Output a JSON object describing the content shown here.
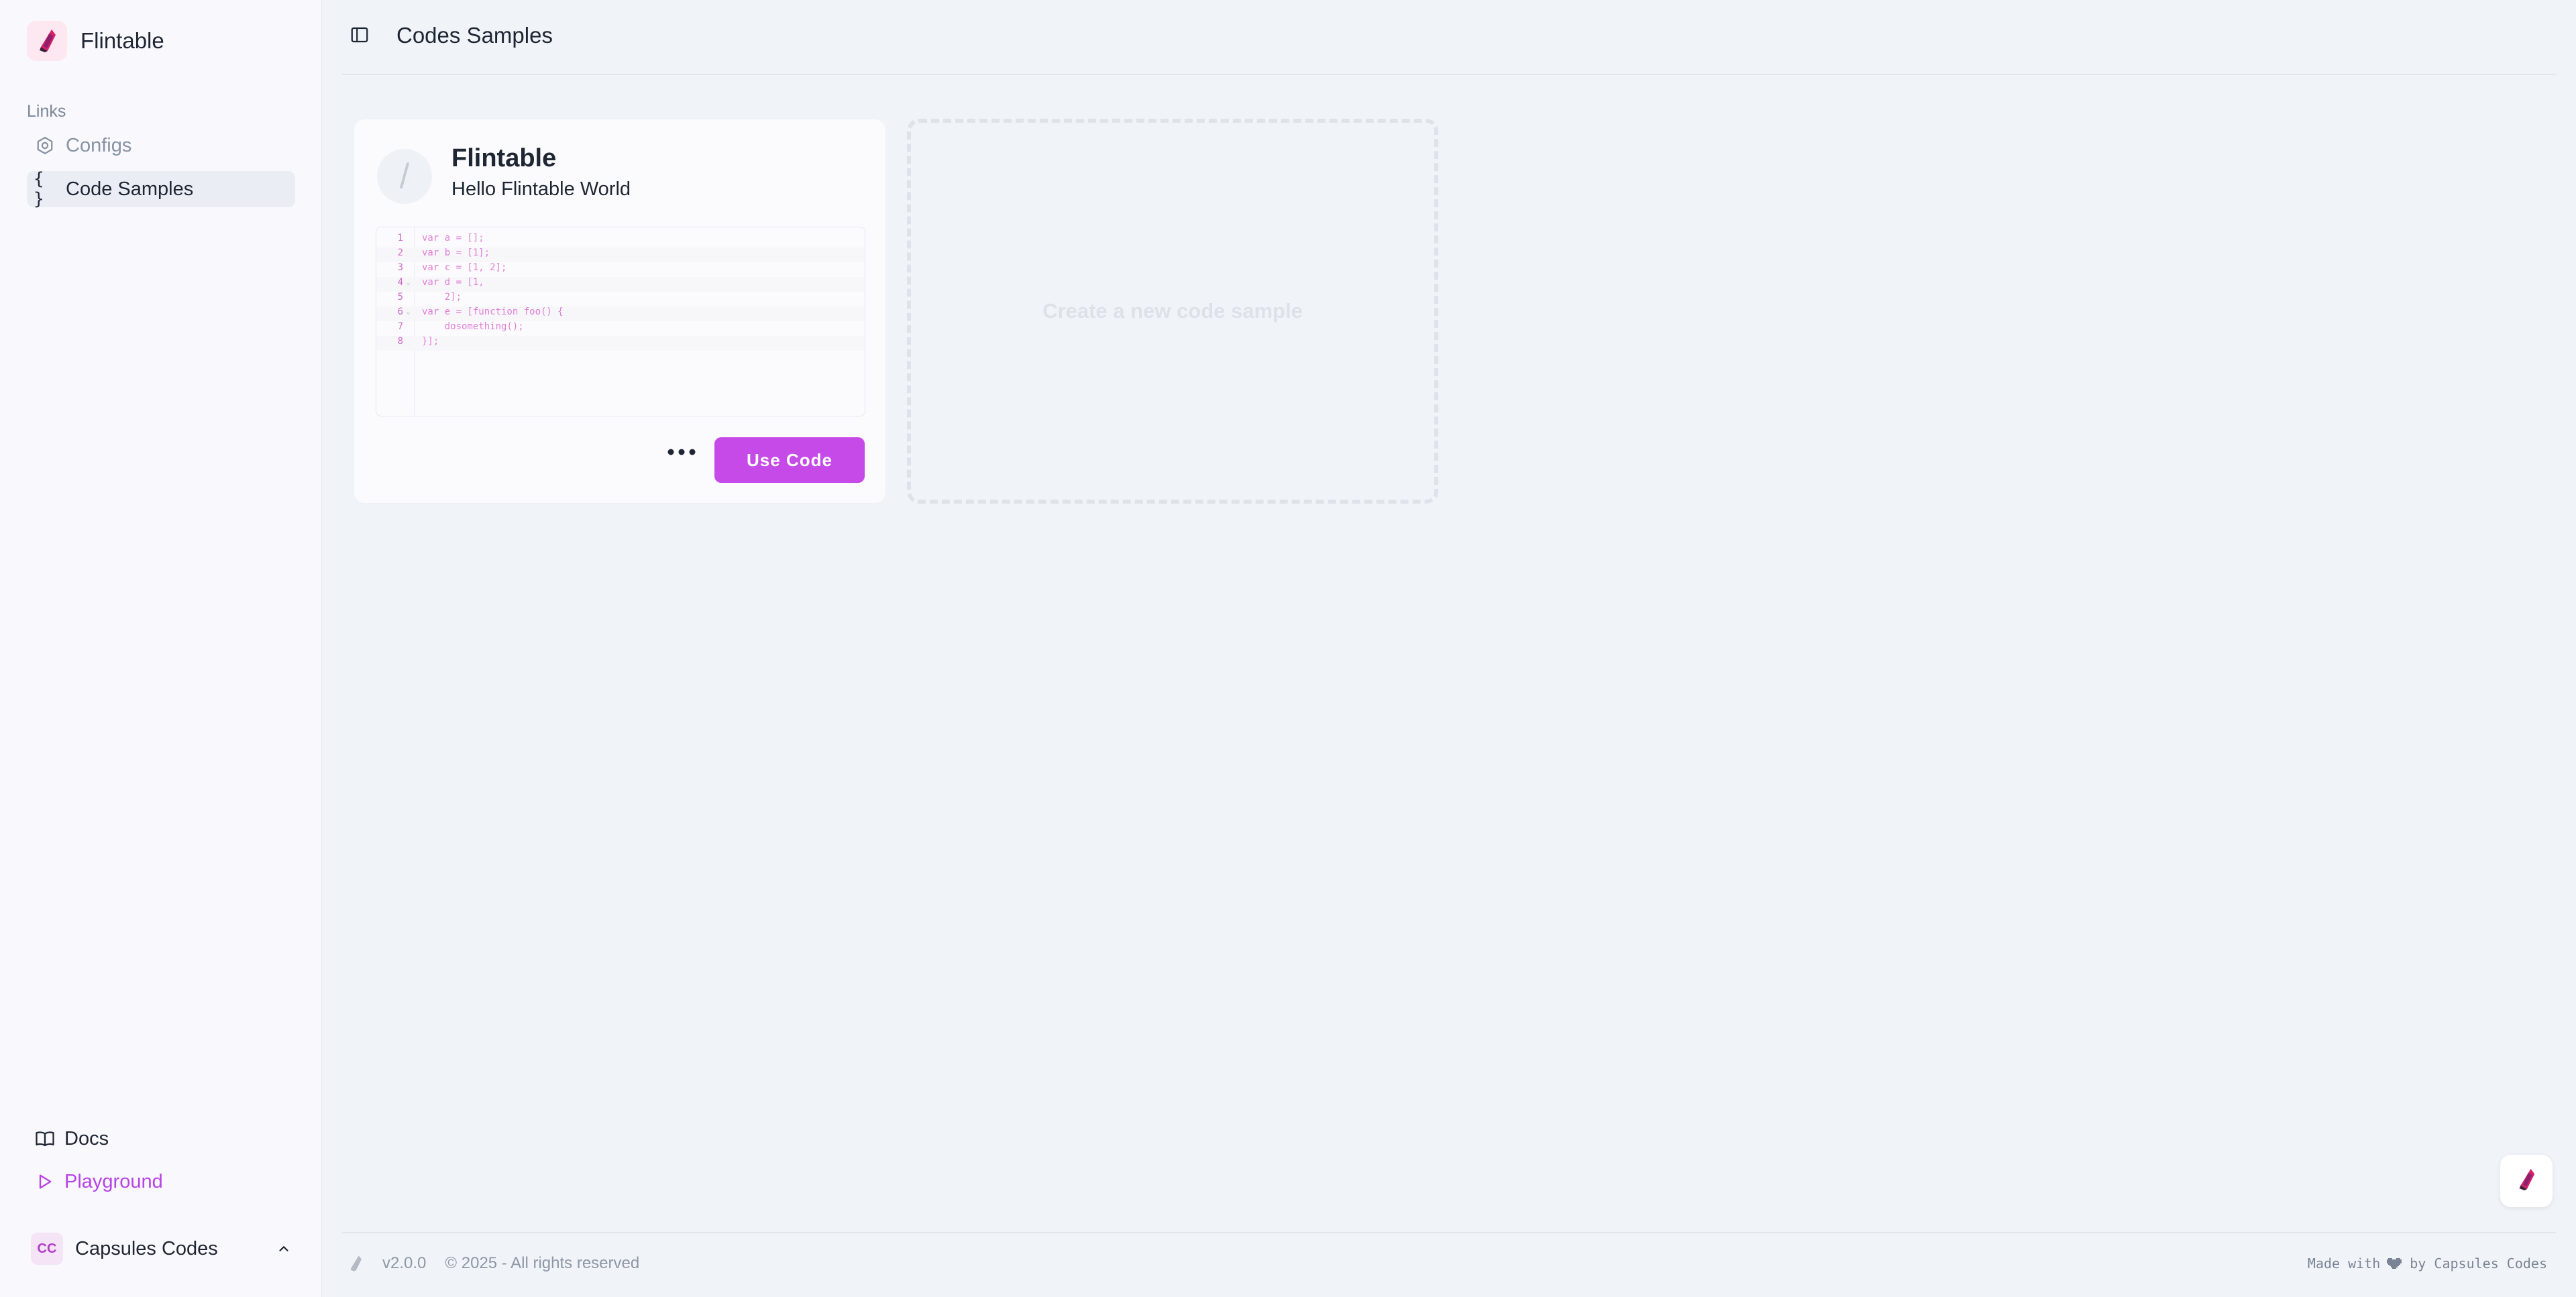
{
  "brand": {
    "name": "Flintable"
  },
  "sidebar": {
    "section_label": "Links",
    "items": [
      {
        "label": "Configs",
        "icon": "gear-icon",
        "active": false
      },
      {
        "label": "Code Samples",
        "icon": "braces-icon",
        "active": true
      }
    ],
    "bottom_links": [
      {
        "label": "Docs",
        "icon": "book-icon"
      },
      {
        "label": "Playground",
        "icon": "play-icon"
      }
    ],
    "user": {
      "initials": "CC",
      "name": "Capsules Codes"
    }
  },
  "header": {
    "title": "Codes Samples"
  },
  "card": {
    "avatar_char": "/",
    "title": "Flintable",
    "subtitle": "Hello Flintable World",
    "code_lines": [
      {
        "n": "1",
        "fold": "",
        "text": "var a = [];"
      },
      {
        "n": "2",
        "fold": "",
        "text": "var b = [1];"
      },
      {
        "n": "3",
        "fold": "",
        "text": "var c = [1, 2];"
      },
      {
        "n": "4",
        "fold": "⌄",
        "text": "var d = [1,"
      },
      {
        "n": "5",
        "fold": "",
        "text": "    2];"
      },
      {
        "n": "6",
        "fold": "⌄",
        "text": "var e = [function foo() {"
      },
      {
        "n": "7",
        "fold": "",
        "text": "    dosomething();"
      },
      {
        "n": "8",
        "fold": "",
        "text": "}];"
      }
    ],
    "use_button": "Use Code"
  },
  "new_card": {
    "label": "Create a new code sample"
  },
  "footer": {
    "version": "v2.0.0",
    "copyright": "© 2025 - All rights reserved",
    "made_with": "Made with",
    "by": "by Capsules Codes"
  },
  "colors": {
    "accent": "#c64ae8",
    "playground": "#b744e4",
    "code": "#e07fd6"
  }
}
